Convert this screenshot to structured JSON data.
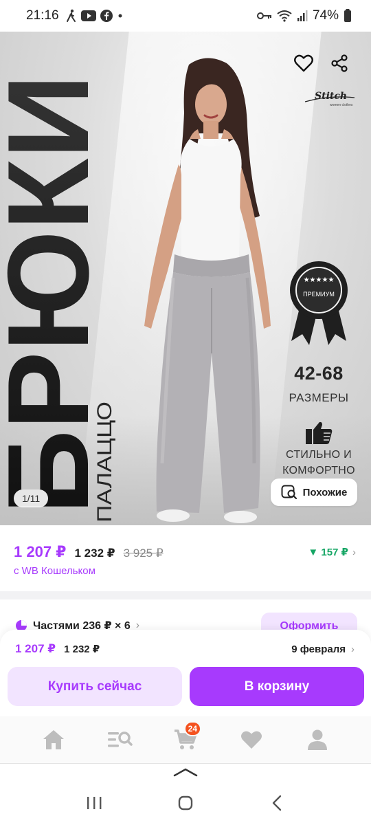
{
  "status_bar": {
    "time": "21:16",
    "battery": "74%",
    "icons_left": [
      "walk-icon",
      "youtube-icon",
      "facebook-icon",
      "dot-icon"
    ],
    "icons_right": [
      "key-icon",
      "wifi-icon",
      "signal-icon",
      "battery-icon"
    ]
  },
  "hero": {
    "title": "БРЮКИ",
    "subtitle": "ПАЛАЦЦО",
    "brand": "Stitch",
    "brand_tagline": "women clothes",
    "badge_text": "ПРЕМИУМ",
    "sizes_range": "42-68",
    "sizes_label": "РАЗМЕРЫ",
    "comfort_line1": "СТИЛЬНО И",
    "comfort_line2": "КОМФОРТНО",
    "counter": "1/11",
    "similar_label": "Похожие"
  },
  "price": {
    "main": "1 207 ₽",
    "second": "1 232 ₽",
    "old": "3 925 ₽",
    "wallet_note": "с WB Кошельком",
    "cashback": "▼ 157 ₽"
  },
  "installments": {
    "label": "Частями 236 ₽ × 6",
    "button": "Оформить"
  },
  "buy_panel": {
    "price_main": "1 207 ₽",
    "price_second": "1 232 ₽",
    "delivery_date": "9 февраля",
    "buy_now_label": "Купить сейчас",
    "cart_label": "В корзину"
  },
  "bottom_nav": {
    "cart_count": "24",
    "items": [
      "home-icon",
      "catalog-search-icon",
      "cart-icon",
      "favorites-icon",
      "profile-icon"
    ]
  },
  "colors": {
    "accent": "#a73afd",
    "accent_light": "#f2e4ff",
    "cashback_green": "#16a665",
    "badge_orange": "#f4521f"
  }
}
